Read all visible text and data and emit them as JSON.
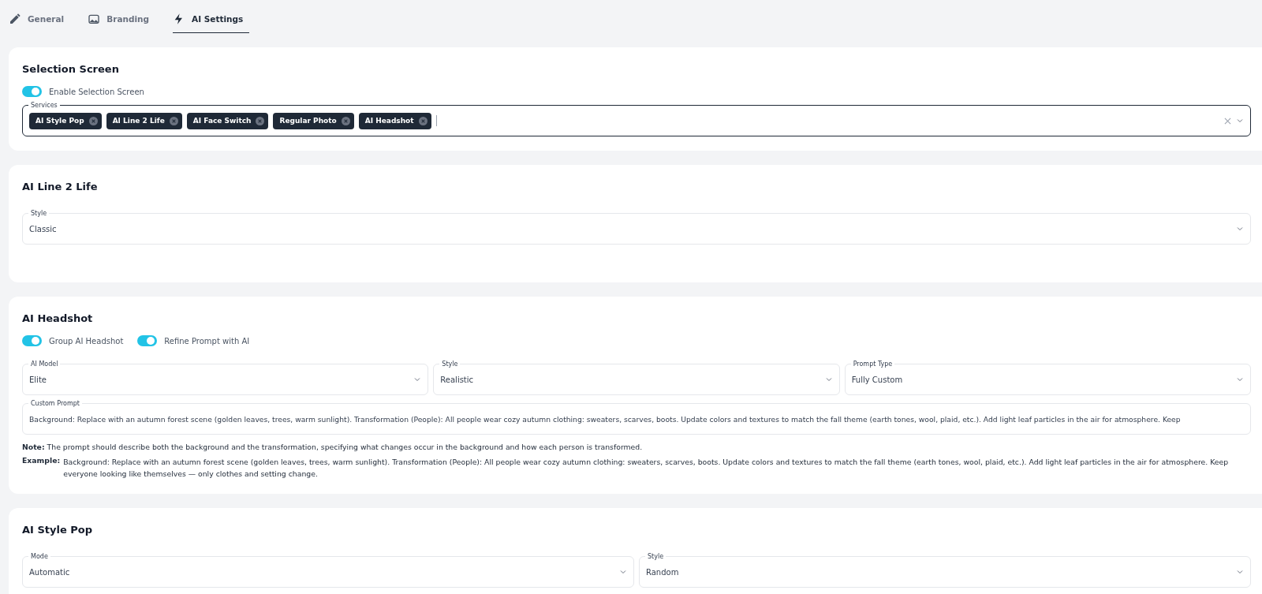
{
  "tabs": [
    {
      "label": "General",
      "kind": "pencil",
      "selected": false
    },
    {
      "label": "Branding",
      "kind": "image",
      "selected": false
    },
    {
      "label": "AI Settings",
      "kind": "bolt",
      "selected": true
    }
  ],
  "sections": [
    {
      "title": "Selection Screen",
      "toggles": [
        {
          "label": "Enable Selection Screen",
          "on": true
        }
      ],
      "fields": [
        {
          "kind": "chips",
          "label": "Services",
          "chips": [
            "AI Style Pop",
            "AI Line 2 Life",
            "AI Face Switch",
            "Regular Photo",
            "AI Headshot"
          ]
        }
      ]
    },
    {
      "title": "AI Line 2 Life",
      "fields": [
        {
          "kind": "select",
          "label": "Style",
          "value": "Classic"
        }
      ]
    },
    {
      "title": "AI Headshot",
      "toggles": [
        {
          "label": "Group AI Headshot",
          "on": true
        },
        {
          "label": "Refine Prompt with AI",
          "on": true
        }
      ],
      "fields": [
        {
          "kind": "select",
          "label": "AI Model",
          "value": "Elite"
        },
        {
          "kind": "select",
          "label": "Style",
          "value": "Realistic"
        },
        {
          "kind": "select",
          "label": "Prompt Type",
          "value": "Fully Custom"
        },
        {
          "kind": "text",
          "label": "Custom Prompt",
          "value": "Background: Replace with an autumn forest scene (golden leaves, trees, warm sunlight).  Transformation (People): All people wear cozy autumn clothing: sweaters, scarves, boots. Update colors and textures to match the fall theme (earth tones, wool, plaid, etc.). Add light leaf particles in the air for atmosphere. Keep"
        }
      ],
      "note": "**Note:** The prompt should describe both the background and the transformation, specifying what changes occur in the background and how each person is transformed.",
      "example": {
        "label": "Example:",
        "text": "Background: Replace with an autumn forest scene (golden leaves, trees, warm sunlight). Transformation (People): All people wear cozy autumn clothing: sweaters, scarves, boots. Update colors and textures to match the fall theme (earth tones, wool, plaid, etc.). Add light leaf particles in the air for atmosphere. Keep everyone looking like themselves — only clothes and setting change."
      }
    },
    {
      "title": "AI Style Pop",
      "fields": [
        {
          "kind": "select",
          "label": "Mode",
          "value": "Automatic"
        },
        {
          "kind": "select",
          "label": "Style",
          "value": "Random"
        }
      ]
    }
  ]
}
